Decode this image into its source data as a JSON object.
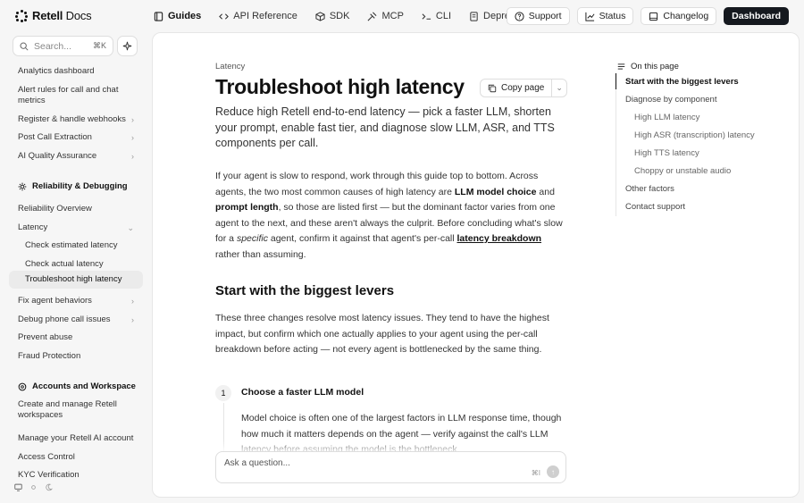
{
  "brand": {
    "name": "Retell",
    "suffix": "Docs"
  },
  "nav": [
    {
      "label": "Guides",
      "icon": "book-icon",
      "active": true
    },
    {
      "label": "API Reference",
      "icon": "code-icon"
    },
    {
      "label": "SDK",
      "icon": "cube-icon"
    },
    {
      "label": "MCP",
      "icon": "mcp-icon"
    },
    {
      "label": "CLI",
      "icon": "terminal-icon"
    },
    {
      "label": "Deprecations",
      "icon": "document-icon"
    }
  ],
  "header_buttons": {
    "support": "Support",
    "status": "Status",
    "changelog": "Changelog",
    "dashboard": "Dashboard"
  },
  "search": {
    "placeholder": "Search...",
    "shortcut": "⌘K"
  },
  "sidebar": {
    "items_top": [
      {
        "label": "Analytics dashboard"
      },
      {
        "label": "Alert rules for call and chat metrics"
      },
      {
        "label": "Register & handle webhooks",
        "chevron": "›"
      },
      {
        "label": "Post Call Extraction",
        "chevron": "›"
      },
      {
        "label": "AI Quality Assurance",
        "chevron": "›"
      }
    ],
    "section_reliability": "Reliability & Debugging",
    "items_reliability": [
      {
        "label": "Reliability Overview"
      },
      {
        "label": "Latency",
        "chevron": "⌄"
      },
      {
        "label": "Check estimated latency"
      },
      {
        "label": "Check actual latency"
      },
      {
        "label": "Troubleshoot high latency"
      },
      {
        "label": "Fix agent behaviors",
        "chevron": "›"
      },
      {
        "label": "Debug phone call issues",
        "chevron": "›"
      },
      {
        "label": "Prevent abuse"
      },
      {
        "label": "Fraud Protection"
      }
    ],
    "section_accounts": "Accounts and Workspace",
    "items_accounts": [
      {
        "label": "Create and manage Retell workspaces"
      },
      {
        "label": "Manage your Retell AI account"
      },
      {
        "label": "Access Control"
      },
      {
        "label": "KYC Verification"
      }
    ]
  },
  "article": {
    "eyebrow": "Latency",
    "title": "Troubleshoot high latency",
    "copy_label": "Copy page",
    "lead": "Reduce high Retell end-to-end latency — pick a faster LLM, shorten your prompt, enable fast tier, and diagnose slow LLM, ASR, and TTS components per call.",
    "p1": {
      "a": "If your agent is slow to respond, work through this guide top to bottom. Across agents, the two most common causes of high latency are ",
      "b1": "LLM model choice",
      "c": " and ",
      "b2": "prompt length",
      "d": ", so those are listed first — but the dominant factor varies from one agent to the next, and these aren't always the culprit. Before concluding what's slow for a ",
      "em": "specific",
      "e": " agent, confirm it against that agent's per-call ",
      "link": "latency breakdown",
      "f": " rather than assuming."
    },
    "h2": "Start with the biggest levers",
    "p2": "These three changes resolve most latency issues. They tend to have the highest impact, but confirm which one actually applies to your agent using the per-call breakdown before acting — not every agent is bottlenecked by the same thing.",
    "step_number": "1",
    "step_title": "Choose a faster LLM model",
    "step_body": "Model choice is often one of the largest factors in LLM response time, though how much it matters depends on the agent — verify against the call's LLM latency before assuming the model is the bottleneck."
  },
  "ask": {
    "placeholder": "Ask a question...",
    "shortcut": "⌘I"
  },
  "toc": {
    "heading": "On this page",
    "items": [
      {
        "label": "Start with the biggest levers",
        "level": 1,
        "active": true
      },
      {
        "label": "Diagnose by component",
        "level": 1
      },
      {
        "label": "High LLM latency",
        "level": 2
      },
      {
        "label": "High ASR (transcription) latency",
        "level": 2
      },
      {
        "label": "High TTS latency",
        "level": 2
      },
      {
        "label": "Choppy or unstable audio",
        "level": 2
      },
      {
        "label": "Other factors",
        "level": 1
      },
      {
        "label": "Contact support",
        "level": 1
      }
    ]
  }
}
